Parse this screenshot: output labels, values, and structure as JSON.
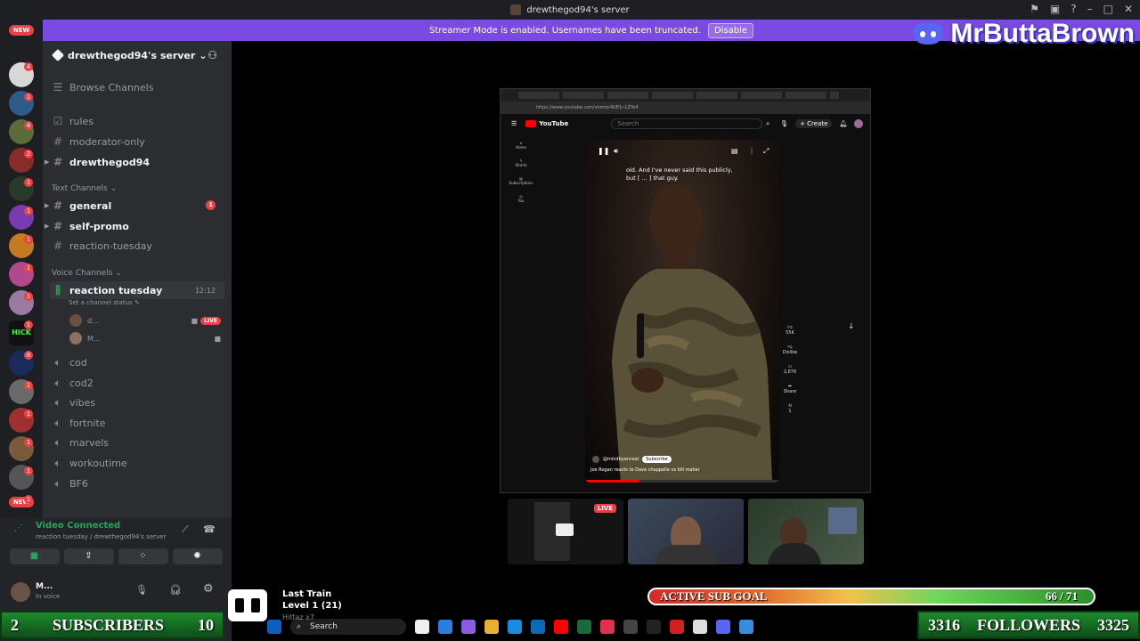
{
  "window": {
    "title": "drewthegod94's server"
  },
  "banner": {
    "text": "Streamer Mode is enabled. Usernames have been truncated.",
    "button": "Disable"
  },
  "brand": {
    "name": "MrButtaBrown"
  },
  "rail": {
    "new_top": "NEW",
    "new_bottom": "NEW",
    "badges": [
      "4",
      "1",
      "4",
      "2",
      "1",
      "1",
      "1",
      "1",
      "1",
      "1",
      "8",
      "1",
      "1",
      "1",
      "1",
      "1",
      "1",
      "1",
      "20",
      "10",
      "16",
      "1",
      "1",
      "8"
    ]
  },
  "sidebar": {
    "server_name": "drewthegod94's server",
    "browse": "Browse Channels",
    "top_channels": [
      "rules",
      "moderator-only",
      "drewthegod94"
    ],
    "text_category": "Text Channels",
    "text_channels": [
      {
        "name": "general",
        "badge": "1"
      },
      {
        "name": "self-promo"
      },
      {
        "name": "reaction-tuesday"
      }
    ],
    "voice_category": "Voice Channels",
    "active_voice": {
      "name": "reaction tuesday",
      "time": "12:12",
      "status": "Set a channel status"
    },
    "voice_users": [
      {
        "name": "d...",
        "live": "LIVE"
      },
      {
        "name": "M..."
      }
    ],
    "voice_channels": [
      "cod",
      "cod2",
      "vibes",
      "fortnite",
      "marvels",
      "workoutime",
      "BF6"
    ]
  },
  "voice_panel": {
    "status": "Video Connected",
    "channel": "reaction tuesday / drewthegod94's server",
    "user": "M...",
    "user_status": "In voice"
  },
  "browser": {
    "url": "https://www.youtube.com/shorts/4UE1r-LZYo4",
    "site": "YouTube",
    "search": "Search",
    "create": "Create",
    "caption": "old. And I've never said this publicly, but [ ... ] that guy.",
    "channel_handle": "@mindbyanceal",
    "subscribe": "Subscribe",
    "short_title": "Joe Rogan reacts to Dave chappelle vs bill maher",
    "nav": [
      "Home",
      "Shorts",
      "Subscriptions",
      "You"
    ],
    "likes": "55K",
    "dislike": "Dislike",
    "comments": "2,876",
    "share": "Share",
    "remix": "1"
  },
  "cams": {
    "live": "LIVE"
  },
  "song": {
    "title": "Last Train",
    "level": "Level 1 (21)",
    "sub": "Hittaz x7"
  },
  "subgoal": {
    "label": "ACTIVE SUB GOAL",
    "value": "66 / 71",
    "progress": 0.93
  },
  "subs": {
    "left": "2",
    "label": "SUBSCRIBERS",
    "right": "10"
  },
  "followers": {
    "left": "3316",
    "label": "FOLLOWERS",
    "right": "3325"
  },
  "taskbar": {
    "search": "Search"
  },
  "colors": {
    "accent": "#7b4ae0",
    "live": "#f23f43",
    "discord": "#5865f2",
    "counter": "#1e8a2e"
  }
}
